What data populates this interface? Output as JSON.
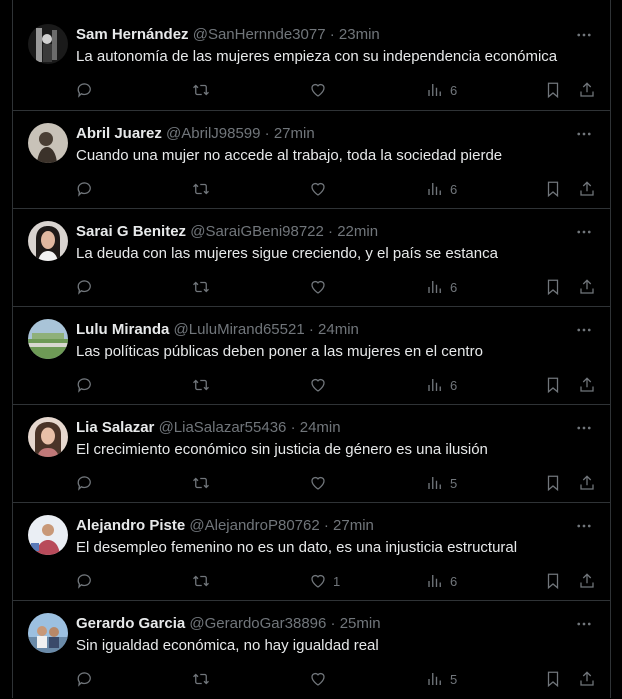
{
  "tweets": [
    {
      "name": "Sam Hernández",
      "handle": "@SanHernnde3077",
      "time": "23min",
      "text": "La autonomía de las mujeres empieza con su independencia económica",
      "likes": "",
      "views": "6",
      "avatar": "avatar-sam"
    },
    {
      "name": "Abril Juarez",
      "handle": "@AbrilJ98599",
      "time": "27min",
      "text": "Cuando una mujer no accede al trabajo, toda la sociedad pierde",
      "likes": "",
      "views": "6",
      "avatar": "avatar-abril"
    },
    {
      "name": "Sarai G Benitez",
      "handle": "@SaraiGBeni98722",
      "time": "22min",
      "text": "La deuda con las mujeres sigue creciendo, y el país se estanca",
      "likes": "",
      "views": "6",
      "avatar": "avatar-sarai"
    },
    {
      "name": "Lulu Miranda",
      "handle": "@LuluMirand65521",
      "time": "24min",
      "text": "Las políticas públicas deben poner a las mujeres en el centro",
      "likes": "",
      "views": "6",
      "avatar": "avatar-lulu"
    },
    {
      "name": "Lia Salazar",
      "handle": "@LiaSalazar55436",
      "time": "24min",
      "text": "El crecimiento económico sin justicia de género es una ilusión",
      "likes": "",
      "views": "5",
      "avatar": "avatar-lia"
    },
    {
      "name": "Alejandro Piste",
      "handle": "@AlejandroP80762",
      "time": "27min",
      "text": "El desempleo femenino no es un dato, es una injusticia estructural",
      "likes": "1",
      "views": "6",
      "avatar": "avatar-alejandro"
    },
    {
      "name": "Gerardo Garcia",
      "handle": "@GerardoGar38896",
      "time": "25min",
      "text": "Sin igualdad económica, no hay igualdad real",
      "likes": "",
      "views": "5",
      "avatar": "avatar-gerardo"
    }
  ],
  "separator": "·"
}
